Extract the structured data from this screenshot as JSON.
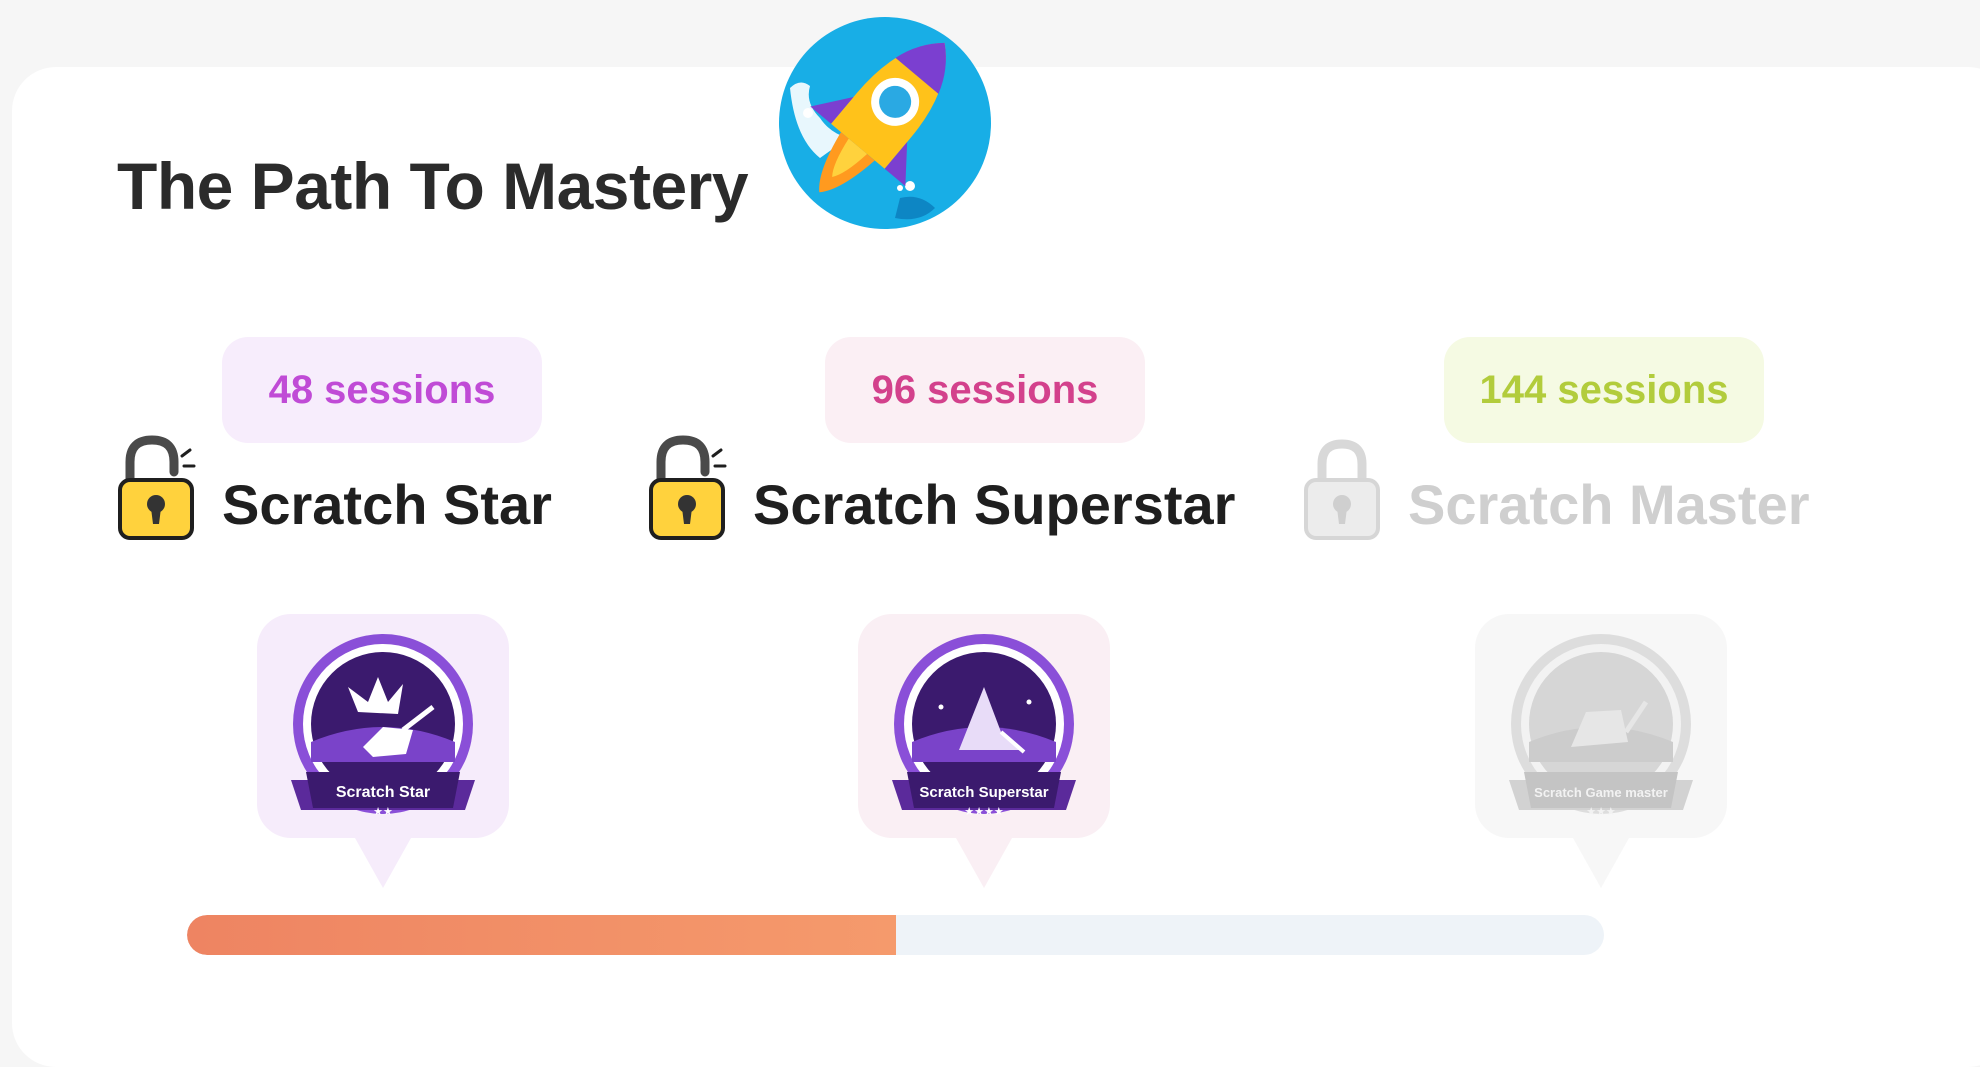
{
  "title": "The Path To Mastery",
  "progress": {
    "fraction": 0.5
  },
  "levels": [
    {
      "sessions": "48 sessions",
      "name": "Scratch Star",
      "badge_label": "Scratch Star",
      "stars": "★★",
      "unlocked": true,
      "pill_bg": "#f7edfc",
      "pill_color": "#c04bd6"
    },
    {
      "sessions": "96 sessions",
      "name": "Scratch Superstar",
      "badge_label": "Scratch Superstar",
      "stars": "★★★★",
      "unlocked": true,
      "pill_bg": "#fbeff4",
      "pill_color": "#d3418c"
    },
    {
      "sessions": "144 sessions",
      "name": "Scratch Master",
      "badge_label": "Scratch Game master",
      "stars": "★★★",
      "unlocked": false,
      "pill_bg": "#f5fae3",
      "pill_color": "#b2cc3c"
    }
  ],
  "colors": {
    "title": "#2b2b2b",
    "locked_text": "#cfcfcf",
    "unlocked_text": "#1f1f1f",
    "badge_purple": "#6f37b4",
    "badge_dark": "#3b1a6e",
    "progress": "#ee8462",
    "track": "#eef3f8"
  },
  "icons": [
    "rocket-icon",
    "unlocked-padlock-icon",
    "locked-padlock-icon",
    "scratch-star-badge-icon",
    "scratch-superstar-badge-icon",
    "scratch-game-master-badge-icon"
  ]
}
